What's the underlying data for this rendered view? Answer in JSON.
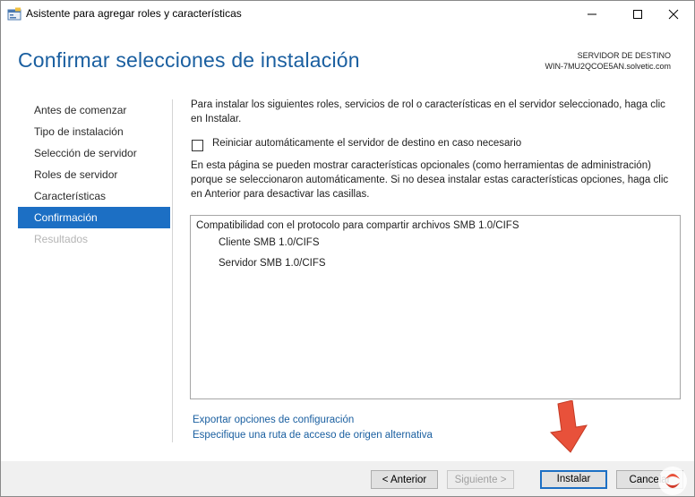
{
  "window": {
    "title": "Asistente para agregar roles y características",
    "icon": "server-manager-wizard-icon"
  },
  "header": {
    "title": "Confirmar selecciones de instalación",
    "destination_label": "SERVIDOR DE DESTINO",
    "destination_server": "WIN-7MU2QCOE5AN.solvetic.com"
  },
  "nav": {
    "items": [
      {
        "label": "Antes de comenzar",
        "state": "normal"
      },
      {
        "label": "Tipo de instalación",
        "state": "normal"
      },
      {
        "label": "Selección de servidor",
        "state": "normal"
      },
      {
        "label": "Roles de servidor",
        "state": "normal"
      },
      {
        "label": "Características",
        "state": "normal"
      },
      {
        "label": "Confirmación",
        "state": "active"
      },
      {
        "label": "Resultados",
        "state": "disabled"
      }
    ]
  },
  "main": {
    "intro_line1": "Para instalar los siguientes roles, servicios de rol o características en el servidor seleccionado, haga clic",
    "intro_line2": "en Instalar.",
    "restart_checkbox_label": "Reiniciar automáticamente el servidor de destino en caso necesario",
    "restart_checked": false,
    "optional_line1": "En esta página se pueden mostrar características opcionales (como herramientas de administración)",
    "optional_line2": "porque se seleccionaron automáticamente. Si no desea instalar estas características opciones, haga clic",
    "optional_line3": "en Anterior para desactivar las casillas.",
    "selections": {
      "feature": "Compatibilidad con el protocolo para compartir archivos SMB 1.0/CIFS",
      "sub_items": [
        "Cliente SMB 1.0/CIFS",
        "Servidor SMB 1.0/CIFS"
      ]
    },
    "export_link": "Exportar opciones de configuración",
    "alt_source_link": "Especifique una ruta de acceso de origen alternativa"
  },
  "footer": {
    "previous_label": "< Anterior",
    "next_label": "Siguiente >",
    "install_label": "Instalar",
    "cancel_label": "Cancelar"
  },
  "colors": {
    "accent": "#1c6fc4",
    "title_blue": "#1a5fa0",
    "arrow": "#e8513a"
  }
}
